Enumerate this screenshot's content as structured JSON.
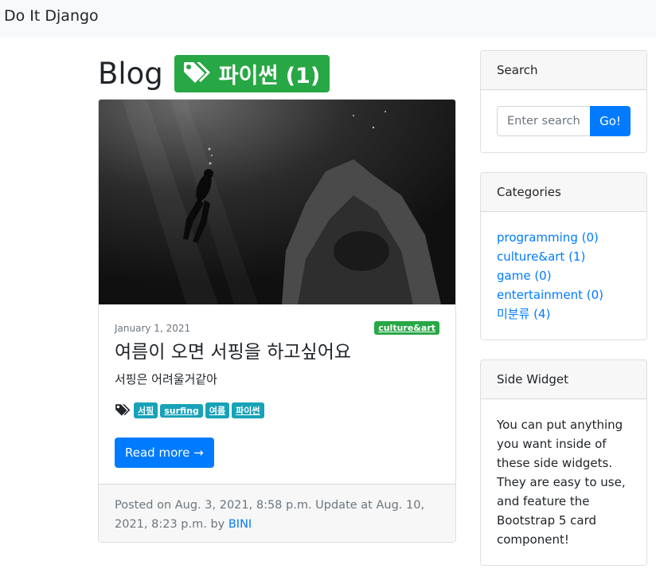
{
  "nav": {
    "brand": "Do It Django"
  },
  "heading": {
    "title": "Blog",
    "tag_label": "파이썬 (1)"
  },
  "post": {
    "date": "January 1, 2021",
    "category": "culture&art",
    "title": "여름이 오면 서핑을 하고싶어요",
    "summary": "서핑은 어려울거같아",
    "tags": [
      "서핑",
      "surfing",
      "여름",
      "파이썬"
    ],
    "read_more": "Read more →",
    "footer_prefix": "Posted on Aug. 3, 2021, 8:58 p.m. Update at Aug. 10, 2021, 8:23 p.m. by ",
    "author": "BINI"
  },
  "search": {
    "title": "Search",
    "placeholder": "Enter search",
    "button": "Go!"
  },
  "categories": {
    "title": "Categories",
    "items": [
      "programming (0)",
      "culture&art (1)",
      "game (0)",
      "entertainment (0)",
      "미분류 (4)"
    ]
  },
  "side_widget": {
    "title": "Side Widget",
    "text": "You can put anything you want inside of these side widgets. They are easy to use, and feature the Bootstrap 5 card component!"
  },
  "colors": {
    "primary": "#007bff",
    "success": "#28a745",
    "info": "#17a2b8",
    "navbar_bg": "#f8f9fa"
  },
  "icons": {
    "heading_tag": "tags-icon",
    "post_tags": "tags-icon"
  }
}
